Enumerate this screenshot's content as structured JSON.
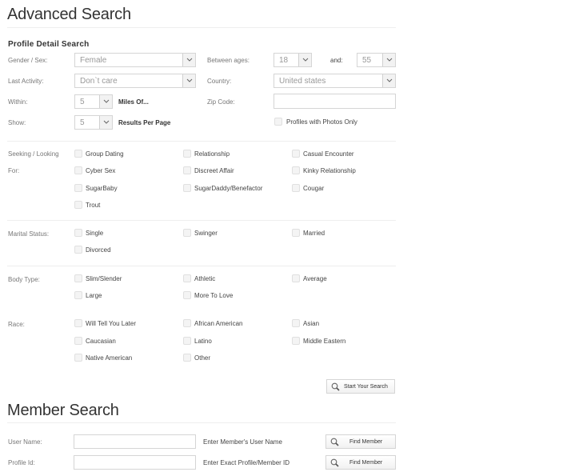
{
  "advanced": {
    "title": "Advanced Search",
    "section_title": "Profile Detail Search",
    "gender": {
      "label": "Gender / Sex:",
      "value": "Female"
    },
    "last_activity": {
      "label": "Last Activity:",
      "value": "Don`t care"
    },
    "within": {
      "label": "Within:",
      "value": "5",
      "suffix": "Miles Of..."
    },
    "show": {
      "label": "Show:",
      "value": "5",
      "suffix": "Results Per Page"
    },
    "ages": {
      "label": "Between ages:",
      "min": "18",
      "and_label": "and:",
      "max": "55"
    },
    "country": {
      "label": "Country:",
      "value": "United states"
    },
    "zip": {
      "label": "Zip Code:",
      "value": ""
    },
    "photos_only": {
      "label": "Profiles with Photos Only",
      "checked": false
    },
    "seeking": {
      "label_line1": "Seeking / Looking",
      "label_line2": "For:",
      "options": [
        "Group Dating",
        "Relationship",
        "Casual Encounter",
        "Cyber Sex",
        "Discreet Affair",
        "Kinky Relationship",
        "SugarBaby",
        "SugarDaddy/Benefactor",
        "Cougar",
        "Trout"
      ]
    },
    "marital": {
      "label": "Marital Status:",
      "options": [
        "Single",
        "Swinger",
        "Married",
        "Divorced"
      ]
    },
    "body": {
      "label": "Body Type:",
      "options": [
        "Slim/Slender",
        "Athletic",
        "Average",
        "Large",
        "More To Love"
      ]
    },
    "race": {
      "label": "Race:",
      "options": [
        "Will Tell You Later",
        "African American",
        "Asian",
        "Caucasian",
        "Latino",
        "Middle Eastern",
        "Native American",
        "Other"
      ]
    },
    "search_button": "Start Your Search"
  },
  "member": {
    "title": "Member Search",
    "username": {
      "label": "User Name:",
      "value": "",
      "hint": "Enter Member's User Name",
      "button": "Find Member"
    },
    "profile_id": {
      "label": "Profile Id:",
      "value": "",
      "hint": "Enter Exact Profile/Member ID",
      "button": "Find Member"
    }
  }
}
